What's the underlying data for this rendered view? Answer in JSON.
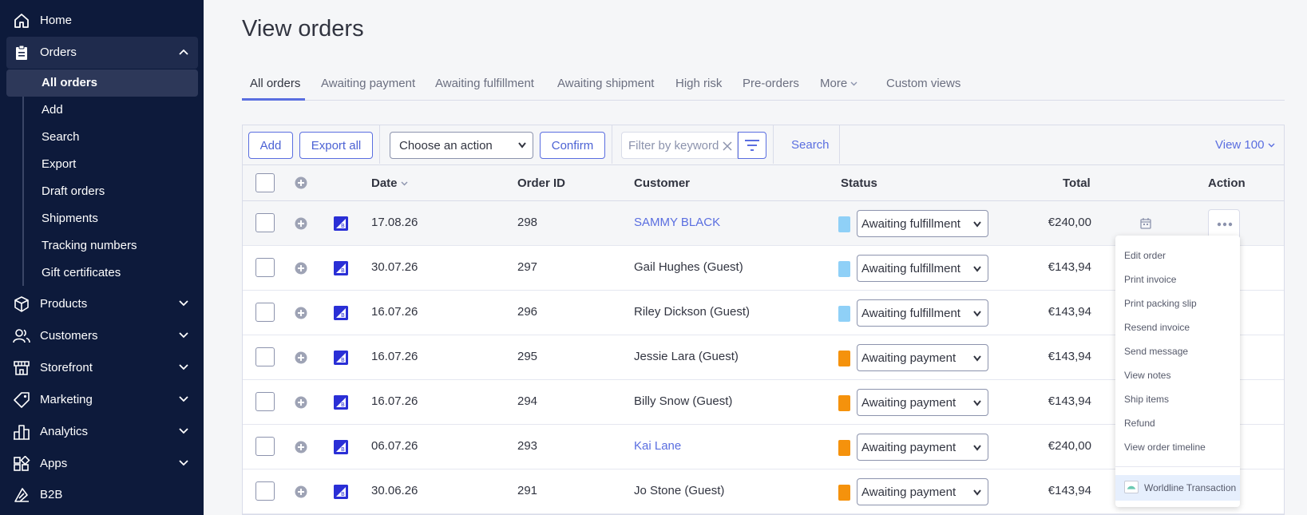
{
  "sidebar": {
    "home": "Home",
    "orders": "Orders",
    "subitems": [
      "All orders",
      "Add",
      "Search",
      "Export",
      "Draft orders",
      "Shipments",
      "Tracking numbers",
      "Gift certificates"
    ],
    "products": "Products",
    "customers": "Customers",
    "storefront": "Storefront",
    "marketing": "Marketing",
    "analytics": "Analytics",
    "apps": "Apps",
    "b2b": "B2B"
  },
  "page": {
    "title": "View orders"
  },
  "tabs": [
    "All orders",
    "Awaiting payment",
    "Awaiting fulfillment",
    "Awaiting shipment",
    "High risk",
    "Pre-orders",
    "More",
    "Custom views"
  ],
  "toolbar": {
    "add": "Add",
    "export_all": "Export all",
    "action_select": "Choose an action",
    "confirm": "Confirm",
    "filter_placeholder": "Filter by keyword",
    "search": "Search",
    "view": "View 100"
  },
  "table": {
    "headers": {
      "date": "Date",
      "order_id": "Order ID",
      "customer": "Customer",
      "status": "Status",
      "total": "Total",
      "action": "Action"
    },
    "rows": [
      {
        "date": "17.08.26",
        "id": "298",
        "customer": "SAMMY BLACK",
        "status": "Awaiting fulfillment",
        "total": "€240,00"
      },
      {
        "date": "30.07.26",
        "id": "297",
        "customer": "Gail Hughes (Guest)",
        "status": "Awaiting fulfillment",
        "total": "€143,94"
      },
      {
        "date": "16.07.26",
        "id": "296",
        "customer": "Riley Dickson (Guest)",
        "status": "Awaiting fulfillment",
        "total": "€143,94"
      },
      {
        "date": "16.07.26",
        "id": "295",
        "customer": "Jessie Lara (Guest)",
        "status": "Awaiting payment",
        "total": "€143,94"
      },
      {
        "date": "16.07.26",
        "id": "294",
        "customer": "Billy Snow (Guest)",
        "status": "Awaiting payment",
        "total": "€143,94"
      },
      {
        "date": "06.07.26",
        "id": "293",
        "customer": "Kai Lane",
        "status": "Awaiting payment",
        "total": "€240,00"
      },
      {
        "date": "30.06.26",
        "id": "291",
        "customer": "Jo Stone (Guest)",
        "status": "Awaiting payment",
        "total": "€143,94"
      }
    ]
  },
  "action_menu": {
    "items": [
      "Edit order",
      "Print invoice",
      "Print packing slip",
      "Resend invoice",
      "Send message",
      "View notes",
      "Ship items",
      "Refund",
      "View order timeline"
    ],
    "worldline": "Worldline Transaction"
  },
  "colors": {
    "sidebar_bg": "#0d1a3b",
    "accent": "#5a6ee0",
    "status_fulfillment": "#8fd0f7",
    "status_payment": "#f5920c"
  }
}
